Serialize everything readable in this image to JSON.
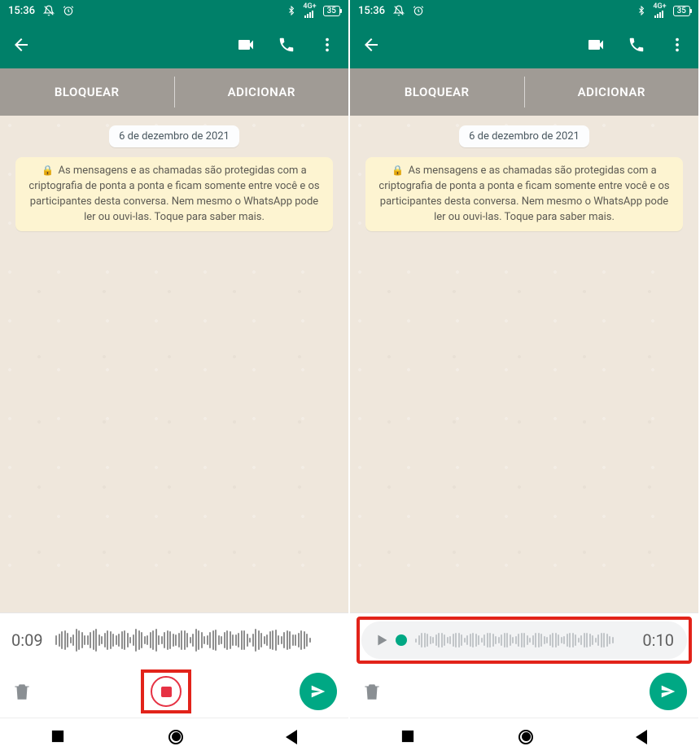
{
  "statusbar": {
    "time": "15:36",
    "battery": "35"
  },
  "actionbar": {
    "block": "BLOQUEAR",
    "add": "ADICIONAR"
  },
  "chat": {
    "date_chip": "6 de dezembro de 2021",
    "encryption_notice": "As mensagens e as chamadas são protegidas com a criptografia de ponta a ponta e ficam somente entre você e os participantes desta conversa. Nem mesmo o WhatsApp pode ler ou ouvi-las. Toque para saber mais."
  },
  "left_screen": {
    "record_time": "0:09"
  },
  "right_screen": {
    "preview_time": "0:10"
  }
}
